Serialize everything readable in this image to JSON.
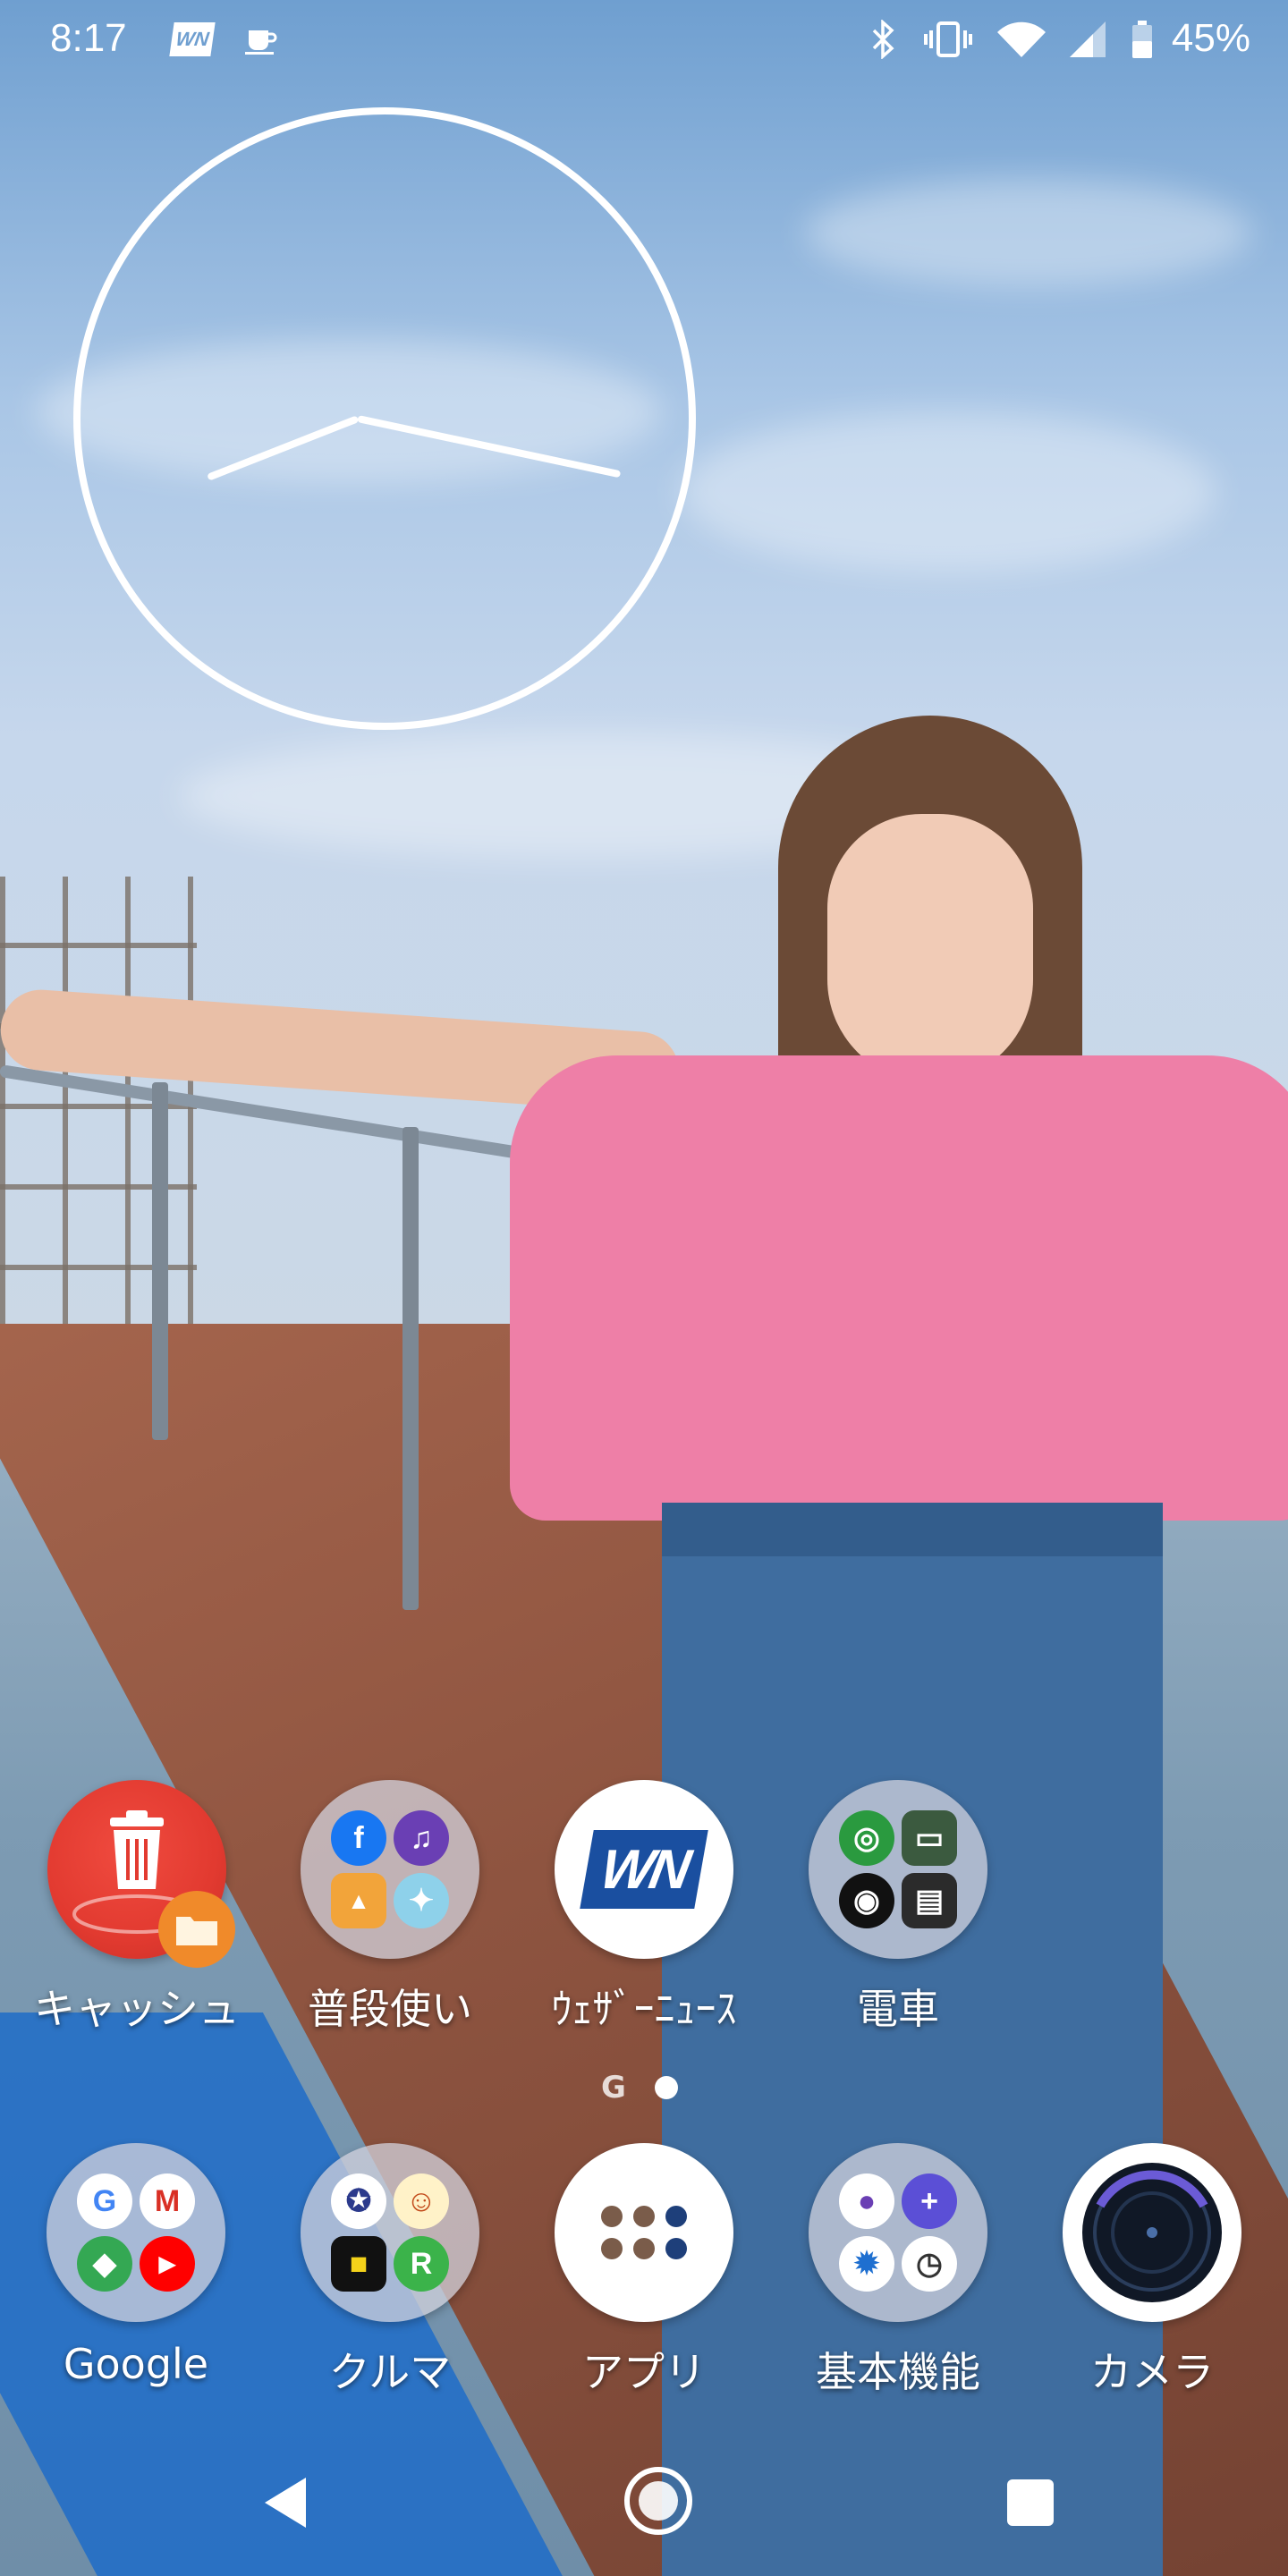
{
  "status_bar": {
    "time": "8:17",
    "notification_icons": [
      "weathernews-icon",
      "cup-icon"
    ],
    "system_icons": [
      "bluetooth-icon",
      "vibrate-icon",
      "wifi-icon",
      "signal-icon",
      "battery-icon"
    ],
    "battery_percent": "45%"
  },
  "clock_widget": {
    "hour": 8,
    "minute": 17
  },
  "home_row": [
    {
      "label": "キャッシュ",
      "icon": "trash-clean-icon"
    },
    {
      "label": "普段使い",
      "icon": "folder-icon",
      "folder_apps": [
        "facebook-icon",
        "music-icon",
        "photos-icon",
        "twitter-bird-icon"
      ]
    },
    {
      "label": "ｳｪｻﾞｰﾆｭｰｽ",
      "icon": "weathernews-icon",
      "icon_text": "WN"
    },
    {
      "label": "電車",
      "icon": "folder-icon",
      "folder_apps": [
        "transit-icon",
        "train-icon",
        "music-disc-icon",
        "ticket-icon"
      ]
    }
  ],
  "pager": {
    "google_label": "G",
    "active_page": 2
  },
  "dock": [
    {
      "label": "Google",
      "icon": "folder-icon",
      "folder_apps": [
        "google-icon",
        "gmail-icon",
        "maps-icon",
        "youtube-icon"
      ]
    },
    {
      "label": "クルマ",
      "icon": "folder-icon",
      "folder_apps": [
        "police-emblem-icon",
        "mascot-icon",
        "timer-icon",
        "navi-icon"
      ]
    },
    {
      "label": "アプリ",
      "icon": "app-drawer-icon"
    },
    {
      "label": "基本機能",
      "icon": "folder-icon",
      "folder_apps": [
        "contacts-icon",
        "messages-icon",
        "settings-icon",
        "clock-icon"
      ]
    },
    {
      "label": "カメラ",
      "icon": "camera-icon"
    }
  ],
  "mini_glyphs": {
    "facebook": "f",
    "music": "♫",
    "photos": "▲",
    "twitter": "✦",
    "google": "G",
    "gmail": "M",
    "maps": "◆",
    "youtube": "▶",
    "transit": "◎",
    "train": "▭",
    "disc": "◉",
    "ticket": "▤",
    "police": "✪",
    "mascot": "☺",
    "timer": "■",
    "navi": "R",
    "contacts": "●",
    "messages": "+",
    "settings": "✹",
    "clock": "◷"
  },
  "colors": {
    "accent_red": "#e8473c",
    "weathernews_blue": "#1a4fa0",
    "folder_bg": "#d2d2dc"
  }
}
